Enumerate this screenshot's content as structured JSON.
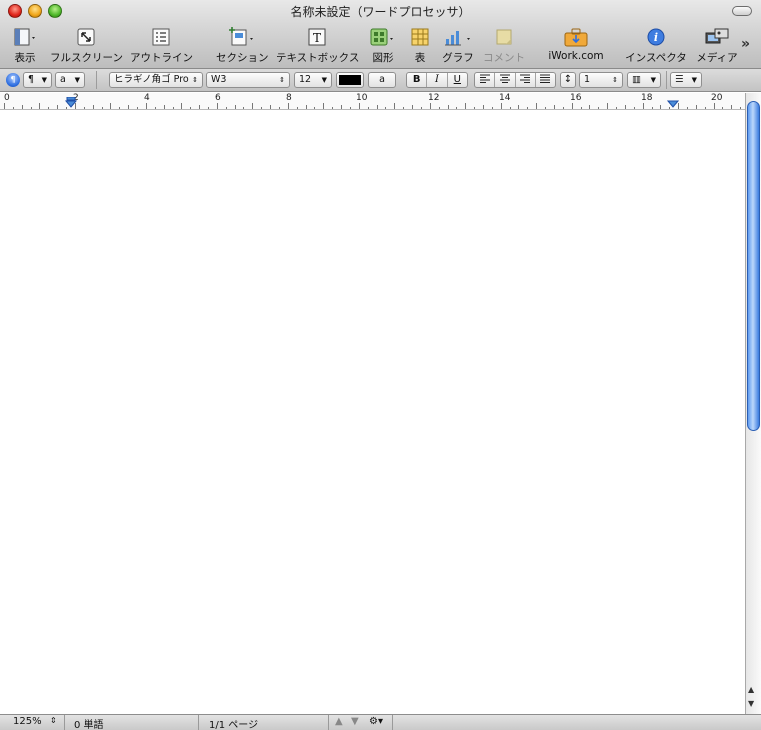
{
  "window": {
    "title": "名称未設定（ワードプロセッサ）"
  },
  "toolbar": {
    "items": [
      {
        "label": "表示",
        "icon": "view-icon"
      },
      {
        "label": "フルスクリーン",
        "icon": "fullscreen-icon"
      },
      {
        "label": "アウトライン",
        "icon": "outline-icon"
      },
      {
        "label": "セクション",
        "icon": "section-icon"
      },
      {
        "label": "テキストボックス",
        "icon": "textbox-icon"
      },
      {
        "label": "図形",
        "icon": "shapes-icon"
      },
      {
        "label": "表",
        "icon": "table-icon"
      },
      {
        "label": "グラフ",
        "icon": "chart-icon"
      },
      {
        "label": "コメント",
        "icon": "comment-icon",
        "disabled": true
      },
      {
        "label": "iWork.com",
        "icon": "iwork-icon"
      },
      {
        "label": "インスペクタ",
        "icon": "inspector-icon"
      },
      {
        "label": "メディア",
        "icon": "media-icon"
      }
    ],
    "overflow": "»"
  },
  "format_bar": {
    "paragraph_style": "¶",
    "character_style": "a",
    "font_family": "ヒラギノ角ゴ Pro",
    "font_weight": "W3",
    "font_size": "12",
    "text_color": "#000000",
    "highlight_label": "a",
    "bold": "B",
    "italic": "I",
    "underline": "U",
    "line_spacing": "1"
  },
  "ruler": {
    "marks": [
      "0",
      "2",
      "4",
      "6",
      "8",
      "10",
      "12",
      "14",
      "16",
      "18",
      "20"
    ]
  },
  "status": {
    "zoom": "125%",
    "word_count": "0 単語",
    "page": "1/1 ページ"
  },
  "colors": {
    "accent": "#2f6fe0",
    "scroll_thumb": "#5e9bf0"
  }
}
